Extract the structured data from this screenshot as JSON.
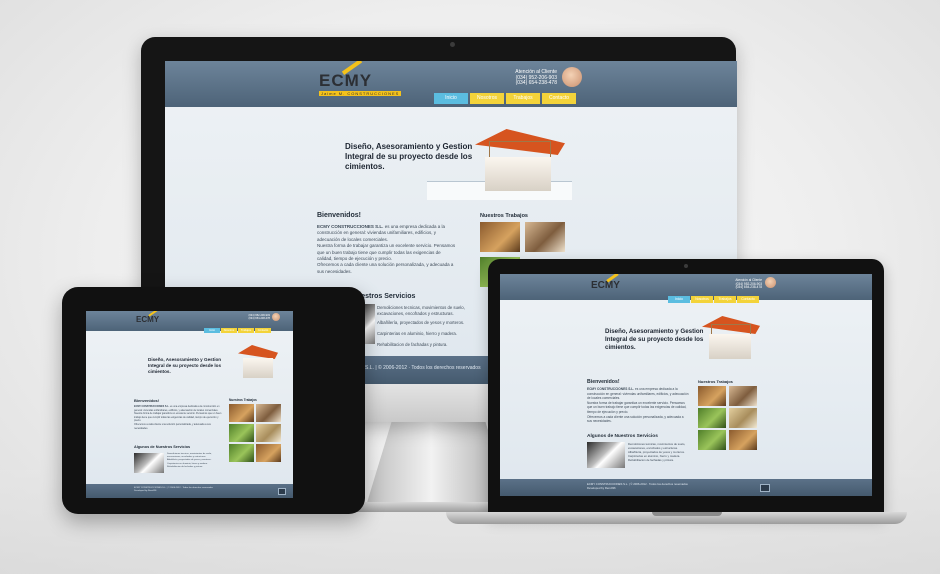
{
  "site": {
    "logo_text": "ECMY",
    "logo_sub": "Jaime M. CONSTRUCCIONES",
    "contact_label": "Atención al Cliente",
    "phone_1": "(034) 952-206-903",
    "phone_2": "(034) 654-238-478",
    "nav": [
      {
        "label": "Inicio",
        "active": true
      },
      {
        "label": "Nosotros",
        "active": false
      },
      {
        "label": "Trabajos",
        "active": false
      },
      {
        "label": "Contacto",
        "active": false
      }
    ],
    "banner_title": "Diseño, Asesoramiento y Gestion Integral de su proyecto desde los cimientos.",
    "welcome_heading": "Bienvenidos!",
    "welcome_company": "ECMY CONSTRUCCIONES S.L.",
    "welcome_p1": "es una empresa dedicada a la construcción en general: viviendas unifamiliares, edificios, y adecuación de locales comerciales.",
    "welcome_p2": "Nuestra forma de trabajar garantiza un excelente servicio. Pensamos que un buen trabajo tiene que cumplir todas las exigencias de calidad, tiempo de ejecución y precio.",
    "welcome_p3": "Ofrecemos a cada cliente una solución personalizada, y adecuada a sus necesidades.",
    "works_heading": "Nuestros Trabajos",
    "services_heading": "Algunos de Nuestros Servicios",
    "services_heading_clipped": "uestros Servicios",
    "services": [
      "Demoliciones tecnicas, movimientos de suelo, excavaciones, encofrados y estructuras.",
      "Albañilería, proyectados de yesos y morteros.",
      "Carpinterias en aluminio, hierro y madera.",
      "Rehabilitacion de fachadas y pintura."
    ],
    "footer_text": "ECMY CONSTRUCCIONES S.L. | © 2006-2012 · Todos los derechos reservados",
    "footer_text_clipped": "ES S.L. | © 2006-2012 · Todos los derechos reservados",
    "footer_credit": "Developed by Rero036"
  },
  "colors": {
    "header": "#5c7388",
    "nav_active": "#5bbde0",
    "nav_inactive": "#f3d33a",
    "roof": "#d6541f",
    "logo_accent": "#f4c21b"
  }
}
